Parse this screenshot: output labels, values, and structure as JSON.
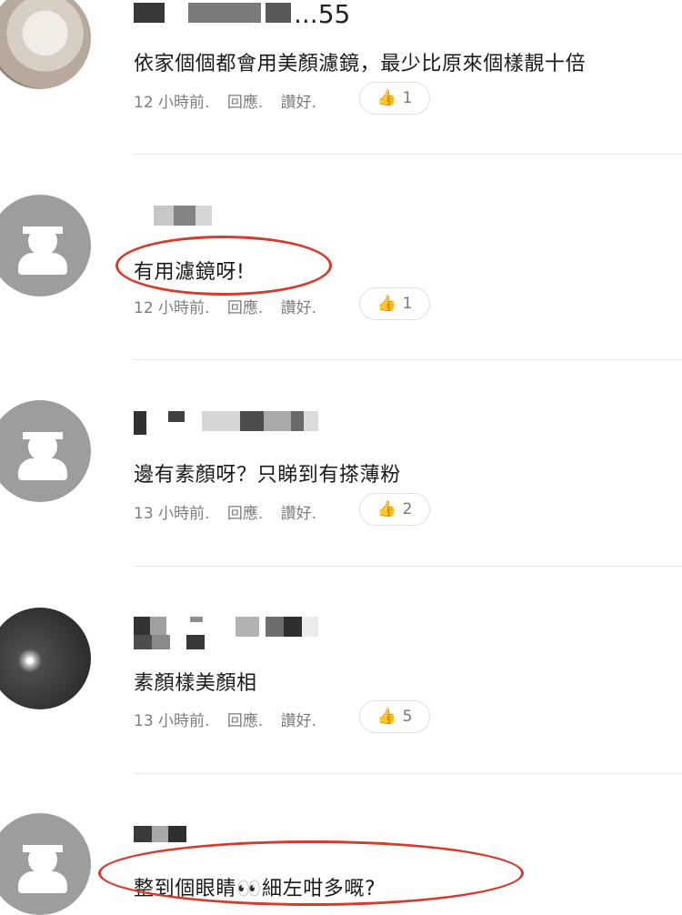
{
  "comments": [
    {
      "avatar_type": "photo",
      "username": "...55",
      "text": "依家個個都會用美顏濾鏡，最少比原來個樣靚十倍",
      "time": "12 小時前.",
      "reply_label": "回應.",
      "like_label": "讚好.",
      "likes": "1"
    },
    {
      "avatar_type": "default",
      "username": "",
      "text": "有用濾鏡呀!",
      "time": "12 小時前.",
      "reply_label": "回應.",
      "like_label": "讚好.",
      "likes": "1"
    },
    {
      "avatar_type": "default",
      "username": "",
      "text": "邊有素顏呀？只睇到有搽薄粉",
      "time": "13 小時前.",
      "reply_label": "回應.",
      "like_label": "讚好.",
      "likes": "2"
    },
    {
      "avatar_type": "moon",
      "username": "",
      "text": "素顏樣美顏相",
      "time": "13 小時前.",
      "reply_label": "回應.",
      "like_label": "讚好.",
      "likes": "5"
    },
    {
      "avatar_type": "default",
      "username": "",
      "text": "整到個眼睛👀細左咁多嘅?",
      "time": "",
      "reply_label": "",
      "like_label": "",
      "likes": ""
    }
  ],
  "icons": {
    "like": "thumbs-up-icon"
  },
  "colors": {
    "highlight": "#d73b2e",
    "avatar_gray": "#9d9d9d",
    "meta_text": "#7d7d7d"
  }
}
